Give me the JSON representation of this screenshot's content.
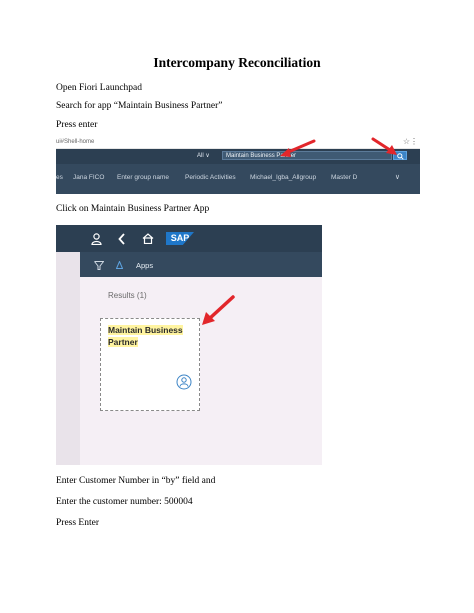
{
  "document": {
    "title": "Intercompany Reconciliation",
    "steps": [
      "Open Fiori Launchpad",
      "Search for app “Maintain Business Partner”",
      "Press enter",
      "Click on Maintain Business Partner App",
      "Enter Customer Number in “by” field and",
      "Enter the customer number: 500004",
      "Press Enter"
    ]
  },
  "screenshot1": {
    "url_fragment": "ui#Shell-home",
    "search_scope": "All",
    "search_value": "Maintain Business Partner",
    "groups": [
      "es",
      "Jana FICO",
      "Enter group name",
      "Periodic Activities",
      "Michael_Igba_Allgroup",
      "Master D"
    ],
    "accent_color": "#e2262b"
  },
  "screenshot2": {
    "logo_text": "SAP",
    "apps_label": "Apps",
    "results_label": "Results (1)",
    "tile_title": [
      "Maintain Business",
      "Partner"
    ],
    "highlight_color": "#fff4a0"
  }
}
